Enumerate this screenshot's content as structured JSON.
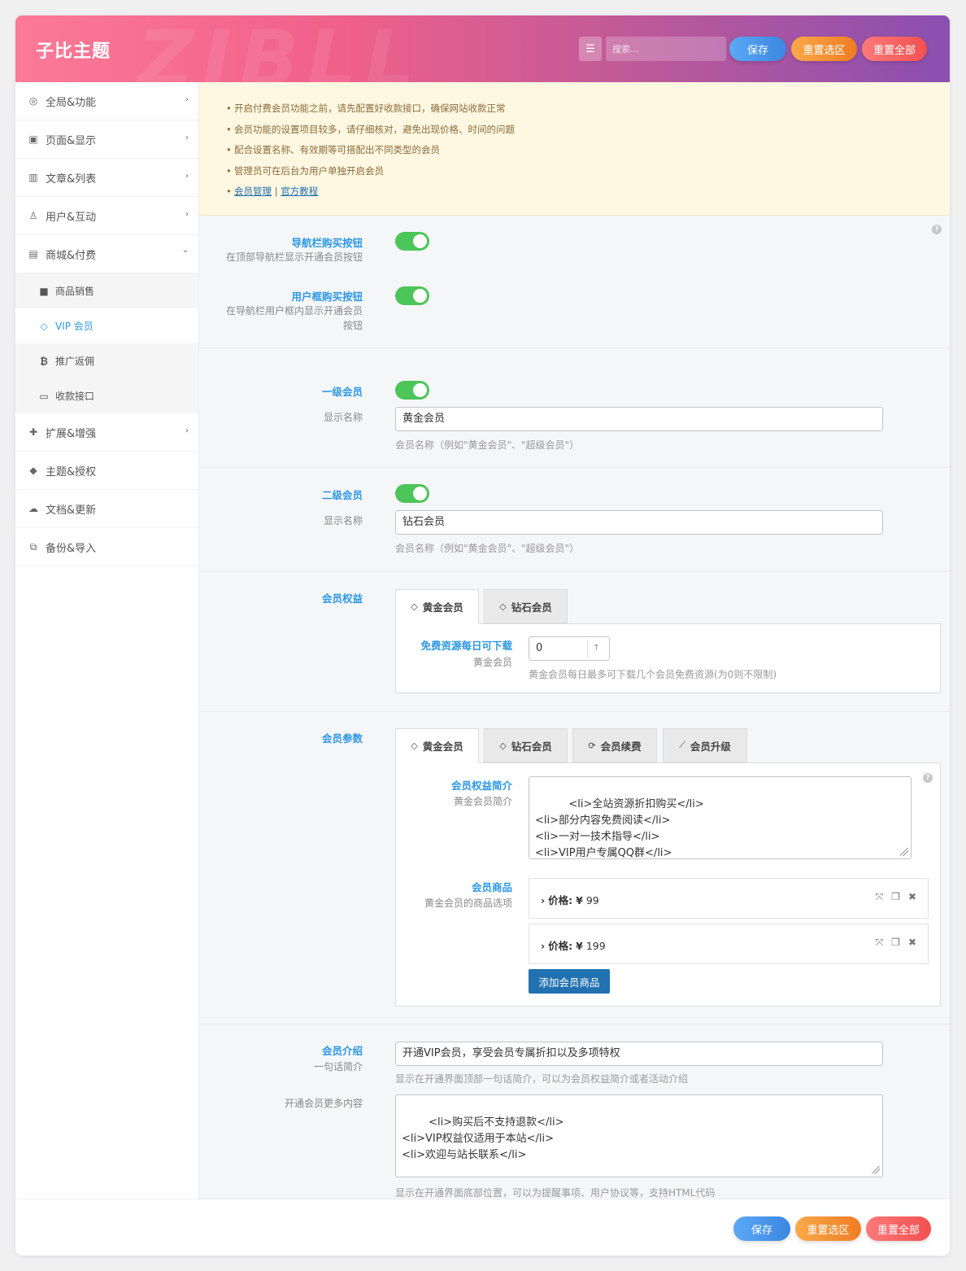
{
  "header": {
    "brand": "子比主题",
    "watermark": "ZIBLL",
    "search_placeholder": "搜索...",
    "save": "保存",
    "reset_section": "重置选区",
    "reset_all": "重置全部"
  },
  "sidebar": {
    "items": [
      {
        "label": "全局&功能",
        "icon": "settings-icon"
      },
      {
        "label": "页面&显示",
        "icon": "calendar-icon"
      },
      {
        "label": "文章&列表",
        "icon": "map-icon"
      },
      {
        "label": "用户&互动",
        "icon": "user-icon"
      },
      {
        "label": "商城&付费",
        "icon": "cart-icon"
      }
    ],
    "sub_items": [
      {
        "label": "商品销售",
        "icon": "shopping-bag-icon"
      },
      {
        "label": "VIP 会员",
        "icon": "diamond-icon"
      },
      {
        "label": "推广返佣",
        "icon": "bitcoin-icon"
      },
      {
        "label": "收款接口",
        "icon": "credit-card-icon"
      }
    ],
    "items_after": [
      {
        "label": "扩展&增强",
        "icon": "puzzle-icon"
      },
      {
        "label": "主题&授权",
        "icon": "shield-icon"
      },
      {
        "label": "文档&更新",
        "icon": "cloud-download-icon"
      },
      {
        "label": "备份&导入",
        "icon": "backup-icon"
      }
    ]
  },
  "notice": {
    "lines": [
      "开启付费会员功能之前，请先配置好收款接口，确保网站收款正常",
      "会员功能的设置项目较多，请仔细核对，避免出现价格、时间的问题",
      "配合设置名称、有效期等可搭配出不同类型的会员",
      "管理员可在后台为用户单独开启会员"
    ],
    "link1": "会员管理",
    "separator": "|",
    "link2": "官方教程"
  },
  "nav_buy": {
    "title": "导航栏购买按钮",
    "desc": "在顶部导航栏显示开通会员按钮",
    "enabled": true
  },
  "user_buy": {
    "title": "用户框购买按钮",
    "desc": "在导航栏用户框内显示开通会员按钮",
    "enabled": true
  },
  "level1": {
    "title": "一级会员",
    "enabled": true,
    "name_label": "显示名称",
    "name_value": "黄金会员",
    "hint": "会员名称（例如\"黄金会员\"、\"超级会员\"）"
  },
  "level2": {
    "title": "二级会员",
    "enabled": true,
    "name_label": "显示名称",
    "name_value": "钻石会员",
    "hint": "会员名称（例如\"黄金会员\"、\"超级会员\"）"
  },
  "rights": {
    "title": "会员权益",
    "tabs": [
      "黄金会员",
      "钻石会员"
    ],
    "field_title": "免费资源每日可下载",
    "field_sub": "黄金会员",
    "value": "0",
    "hint": "黄金会员每日最多可下载几个会员免费资源(为0则不限制)"
  },
  "params": {
    "title": "会员参数",
    "tabs": [
      "黄金会员",
      "钻石会员",
      "会员续费",
      "会员升级"
    ],
    "intro_title": "会员权益简介",
    "intro_sub": "黄金会员简介",
    "intro_value": "<li>全站资源折扣购买</li>\n<li>部分内容免费阅读</li>\n<li>一对一技术指导</li>\n<li>VIP用户专属QQ群</li>",
    "goods_title": "会员商品",
    "goods_sub": "黄金会员的商品选项",
    "goods": [
      {
        "label": "价格:",
        "currency": "¥",
        "price": "99"
      },
      {
        "label": "价格:",
        "currency": "¥",
        "price": "199"
      }
    ],
    "add_button": "添加会员商品"
  },
  "intro": {
    "title": "会员介绍",
    "sub": "一句话简介",
    "value": "开通VIP会员，享受会员专属折扣以及多项特权",
    "hint": "显示在开通界面顶部一句话简介，可以为会员权益简介或者活动介绍",
    "more_label": "开通会员更多内容",
    "more_value": "<li>购买后不支持退款</li>\n<li>VIP权益仅适用于本站</li>\n<li>欢迎与站长联系</li>",
    "more_hint": "显示在开通界面底部位置，可以为提醒事项、用户协议等，支持HTML代码"
  },
  "footer": {
    "save": "保存",
    "reset_section": "重置选区",
    "reset_all": "重置全部"
  }
}
